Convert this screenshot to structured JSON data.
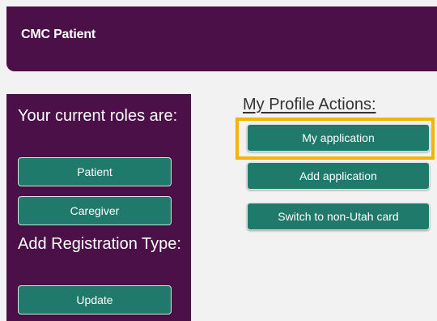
{
  "header": {
    "title": "CMC Patient"
  },
  "sidebar": {
    "roles_heading": "Your current roles are:",
    "roles": [
      {
        "label": "Patient"
      },
      {
        "label": "Caregiver"
      }
    ],
    "add_registration_heading": "Add Registration Type:",
    "update_label": "Update"
  },
  "profile_actions": {
    "title": "My Profile Actions:",
    "buttons": [
      {
        "label": "My application",
        "highlighted": true
      },
      {
        "label": "Add application"
      },
      {
        "label": "Switch to non-Utah card"
      }
    ]
  },
  "colors": {
    "brand_purple": "#4a1047",
    "button_teal": "#1f7a6b",
    "highlight_yellow": "#f6b400",
    "background": "#f2f2f2"
  }
}
